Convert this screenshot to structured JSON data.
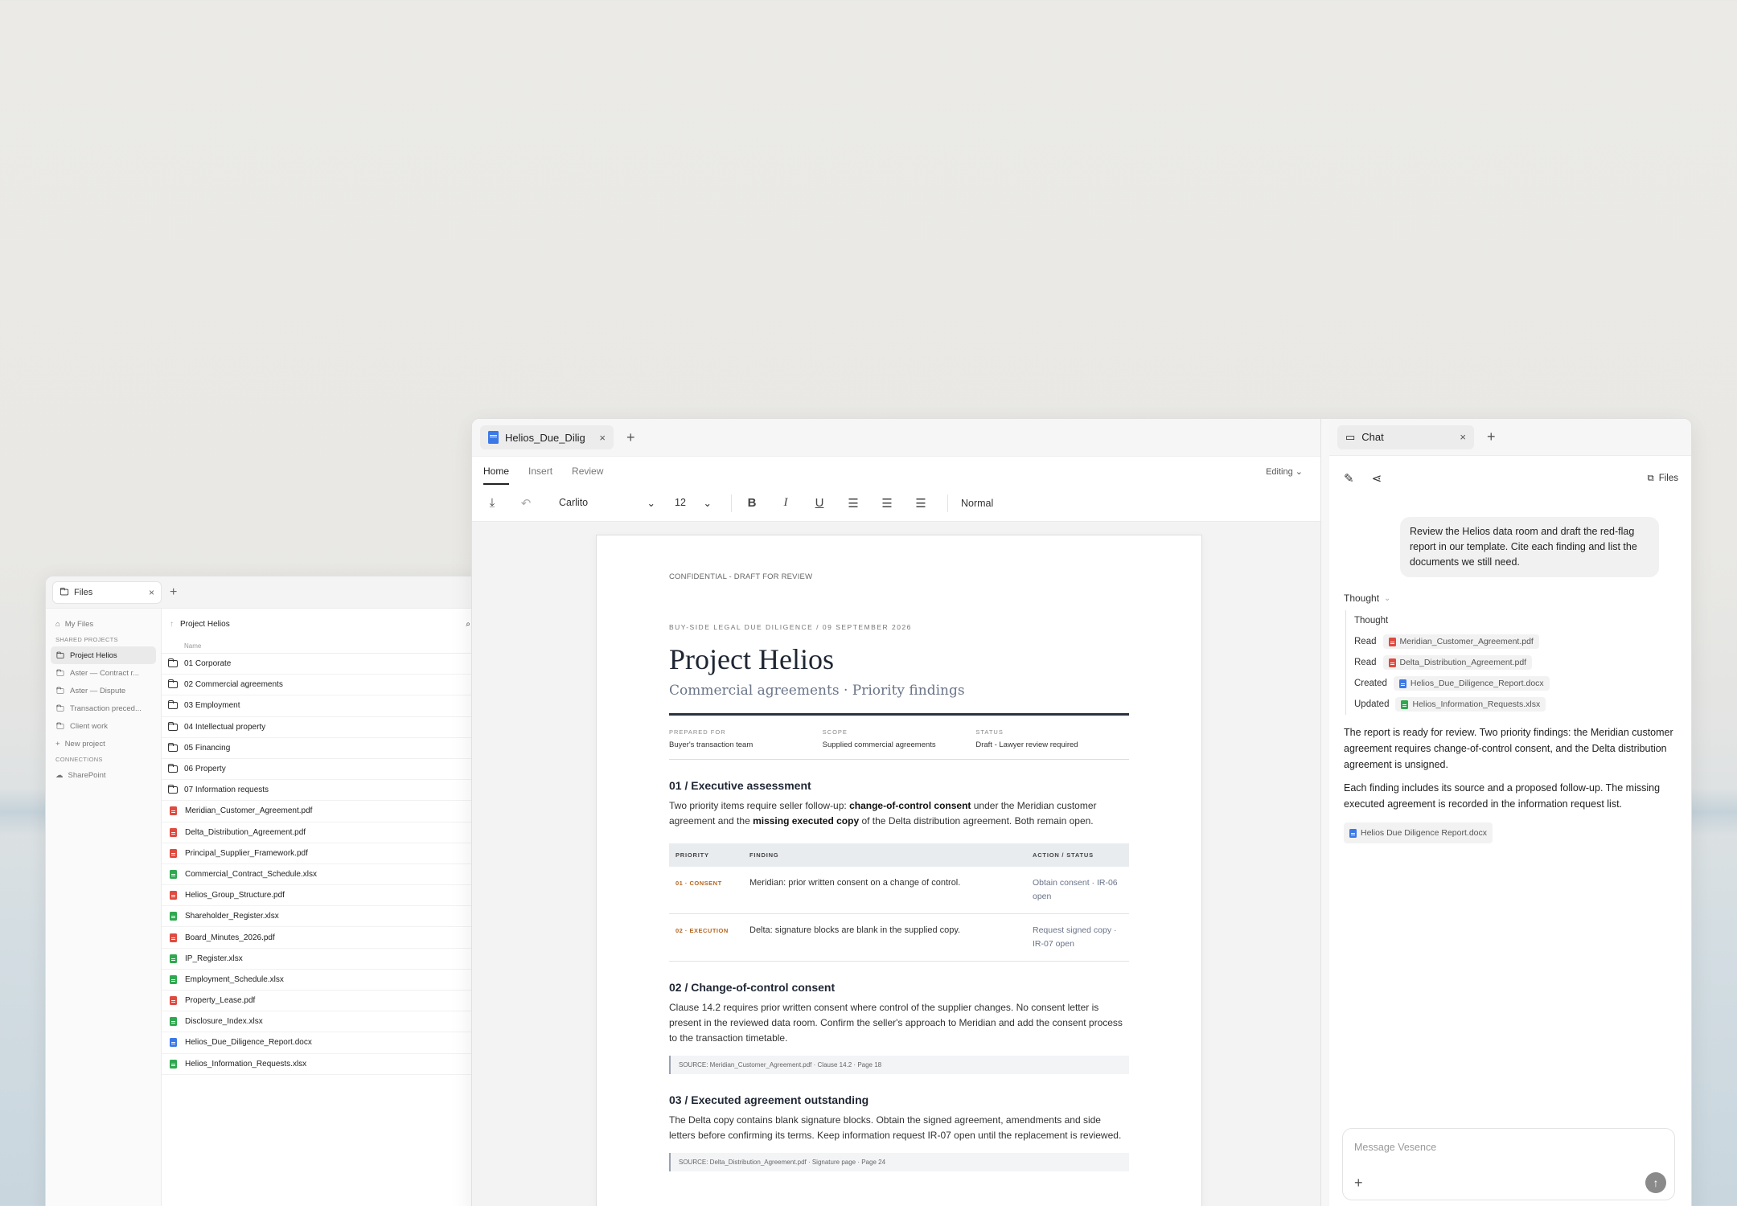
{
  "files_window": {
    "tab_title": "Files",
    "sidebar": {
      "my_files": "My Files",
      "shared_heading": "SHARED PROJECTS",
      "projects": [
        "Project Helios",
        "Aster — Contract r...",
        "Aster — Dispute",
        "Transaction preced...",
        "Client work"
      ],
      "new_project": "New project",
      "connections_heading": "CONNECTIONS",
      "sharepoint": "SharePoint"
    },
    "breadcrumb": "Project Helios",
    "col_name": "Name",
    "folders": [
      "01 Corporate",
      "02 Commercial agreements",
      "03 Employment",
      "04 Intellectual property",
      "05 Financing",
      "06 Property",
      "07 Information requests"
    ],
    "files": [
      {
        "name": "Meridian_Customer_Agreement.pdf",
        "type": "pdf"
      },
      {
        "name": "Delta_Distribution_Agreement.pdf",
        "type": "pdf"
      },
      {
        "name": "Principal_Supplier_Framework.pdf",
        "type": "pdf"
      },
      {
        "name": "Commercial_Contract_Schedule.xlsx",
        "type": "xls"
      },
      {
        "name": "Helios_Group_Structure.pdf",
        "type": "pdf"
      },
      {
        "name": "Shareholder_Register.xlsx",
        "type": "xls"
      },
      {
        "name": "Board_Minutes_2026.pdf",
        "type": "pdf"
      },
      {
        "name": "IP_Register.xlsx",
        "type": "xls"
      },
      {
        "name": "Employment_Schedule.xlsx",
        "type": "xls"
      },
      {
        "name": "Property_Lease.pdf",
        "type": "pdf"
      },
      {
        "name": "Disclosure_Index.xlsx",
        "type": "xls"
      },
      {
        "name": "Helios_Due_Diligence_Report.docx",
        "type": "doc"
      },
      {
        "name": "Helios_Information_Requests.xlsx",
        "type": "xls"
      }
    ]
  },
  "doc_pane": {
    "tab_title": "Helios_Due_Diligence_Report.docx",
    "menus": [
      "Home",
      "Insert",
      "Review"
    ],
    "mode": "Editing",
    "font": "Carlito",
    "size": "12",
    "style": "Normal",
    "page": {
      "confidential": "CONFIDENTIAL - DRAFT FOR REVIEW",
      "eyebrow": "BUY-SIDE LEGAL DUE DILIGENCE / 09 SEPTEMBER 2026",
      "title": "Project Helios",
      "subtitle": "Commercial agreements · Priority findings",
      "meta": [
        {
          "k": "PREPARED FOR",
          "v": "Buyer's transaction team"
        },
        {
          "k": "SCOPE",
          "v": "Supplied commercial agreements"
        },
        {
          "k": "STATUS",
          "v": "Draft - Lawyer review required"
        }
      ],
      "s1_heading": "01 / Executive assessment",
      "s1_p_a": "Two priority items require seller follow-up: ",
      "s1_p_b": "change-of-control consent",
      "s1_p_c": " under the Meridian customer agreement and the ",
      "s1_p_d": "missing executed copy",
      "s1_p_e": " of the Delta distribution agreement. Both remain open.",
      "table_headers": [
        "PRIORITY",
        "FINDING",
        "ACTION / STATUS"
      ],
      "table_rows": [
        {
          "priority": "01 · CONSENT",
          "finding": "Meridian: prior written consent on a change of control.",
          "action": "Obtain consent · IR-06 open"
        },
        {
          "priority": "02 · EXECUTION",
          "finding": "Delta: signature blocks are blank in the supplied copy.",
          "action": "Request signed copy · IR-07 open"
        }
      ],
      "s2_heading": "02 / Change-of-control consent",
      "s2_p": "Clause 14.2 requires prior written consent where control of the supplier changes. No consent letter is present in the reviewed data room. Confirm the seller's approach to Meridian and add the consent process to the transaction timetable.",
      "s2_src": "SOURCE: Meridian_Customer_Agreement.pdf · Clause 14.2 · Page 18",
      "s3_heading": "03 / Executed agreement outstanding",
      "s3_p": "The Delta copy contains blank signature blocks. Obtain the signed agreement, amendments and side letters before confirming its terms. Keep information request IR-07 open until the replacement is reviewed.",
      "s3_src": "SOURCE: Delta_Distribution_Agreement.pdf · Signature page · Page 24"
    }
  },
  "chat": {
    "tab_title": "Chat",
    "files_label": "Files",
    "user_message": "Review the Helios data room and draft the red-flag report in our template. Cite each finding and list the documents we still need.",
    "thought_label": "Thought",
    "steps": [
      {
        "verb": "Thought",
        "file": "",
        "type": ""
      },
      {
        "verb": "Read",
        "file": "Meridian_Customer_Agreement.pdf",
        "type": "pdf"
      },
      {
        "verb": "Read",
        "file": "Delta_Distribution_Agreement.pdf",
        "type": "pdf"
      },
      {
        "verb": "Created",
        "file": "Helios_Due_Diligence_Report.docx",
        "type": "doc"
      },
      {
        "verb": "Updated",
        "file": "Helios_Information_Requests.xlsx",
        "type": "xls"
      }
    ],
    "answer_p1": "The report is ready for review. Two priority findings: the Meridian customer agreement requires change-of-control consent, and the Delta distribution agreement is unsigned.",
    "answer_p2": "Each finding includes its source and a proposed follow-up. The missing executed agreement is recorded in the information request list.",
    "attachment": "Helios Due Diligence Report.docx",
    "input_placeholder": "Message Vesence"
  }
}
